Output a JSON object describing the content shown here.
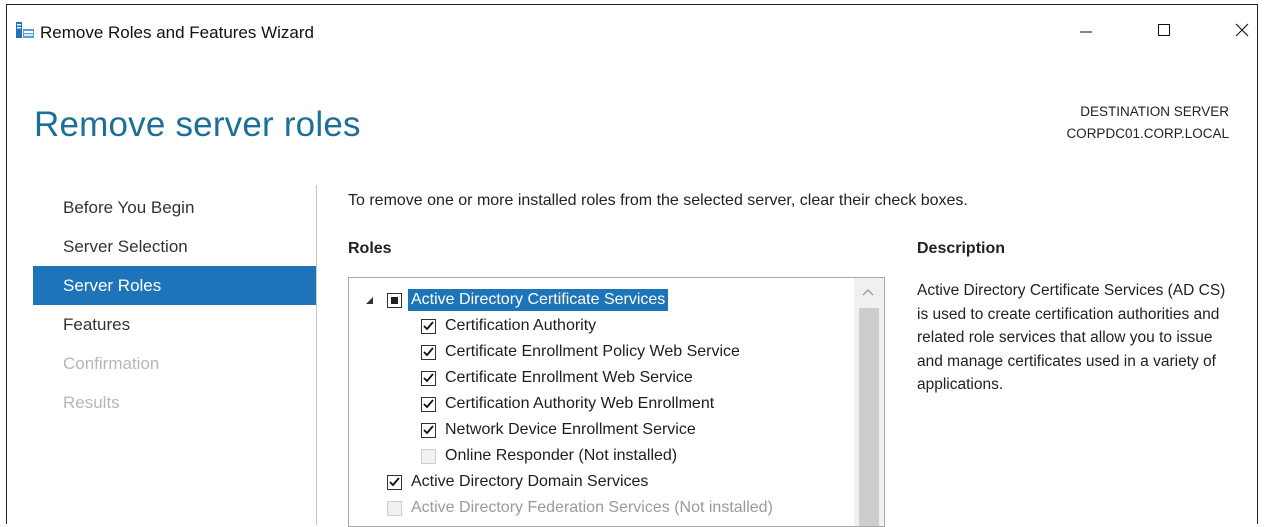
{
  "window": {
    "title": "Remove Roles and Features Wizard",
    "icon": "server-manager-icon",
    "controls": [
      "minimize-icon",
      "maximize-icon",
      "close-icon"
    ]
  },
  "header": {
    "page_title": "Remove server roles",
    "destination_label": "DESTINATION SERVER",
    "destination_server": "CORPDC01.CORP.LOCAL"
  },
  "nav": {
    "items": [
      {
        "label": "Before You Begin",
        "state": "normal"
      },
      {
        "label": "Server Selection",
        "state": "normal"
      },
      {
        "label": "Server Roles",
        "state": "active"
      },
      {
        "label": "Features",
        "state": "normal"
      },
      {
        "label": "Confirmation",
        "state": "disabled"
      },
      {
        "label": "Results",
        "state": "disabled"
      }
    ]
  },
  "main": {
    "instruction": "To remove one or more installed roles from the selected server, clear their check boxes.",
    "roles_heading": "Roles",
    "description_heading": "Description",
    "description_text": "Active Directory Certificate Services (AD CS) is used to create certification authorities and related role services that allow you to issue and manage certificates used in a variety of applications.",
    "roles": [
      {
        "label": "Active Directory Certificate Services",
        "state": "partial",
        "level": 0,
        "expanded": true,
        "selected": true
      },
      {
        "label": "Certification Authority",
        "state": "checked",
        "level": 1
      },
      {
        "label": "Certificate Enrollment Policy Web Service",
        "state": "checked",
        "level": 1
      },
      {
        "label": "Certificate Enrollment Web Service",
        "state": "checked",
        "level": 1
      },
      {
        "label": "Certification Authority Web Enrollment",
        "state": "checked",
        "level": 1
      },
      {
        "label": "Network Device Enrollment Service",
        "state": "checked",
        "level": 1
      },
      {
        "label": "Online Responder (Not installed)",
        "state": "disabled",
        "level": 1
      },
      {
        "label": "Active Directory Domain Services",
        "state": "checked",
        "level": 0
      },
      {
        "label": "Active Directory Federation Services (Not installed)",
        "state": "disabled",
        "level": 0
      }
    ]
  },
  "colors": {
    "accent": "#1e74b9",
    "title_blue": "#1c6f99",
    "disabled_text": "#b7b7b7"
  }
}
